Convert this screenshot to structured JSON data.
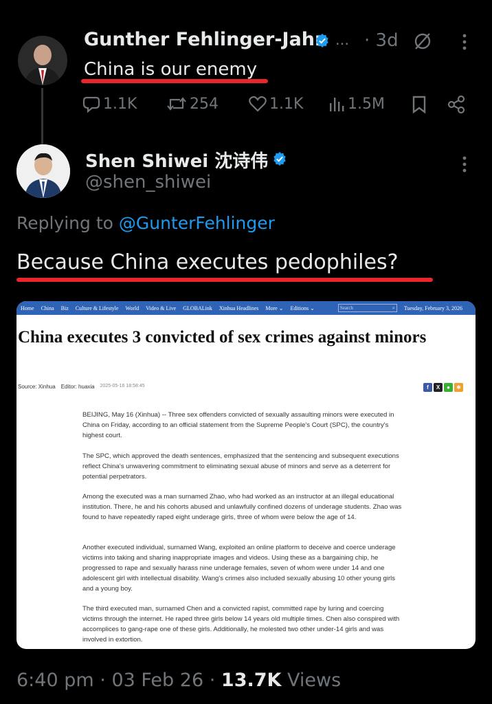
{
  "tweet1": {
    "author": "Gunther Fehlinger-Jahn",
    "ellipsis": "...",
    "time": "· 3d",
    "text": "China is our enemy",
    "replies": "1.1K",
    "reposts": "254",
    "likes": "1.1K",
    "views": "1.5M"
  },
  "tweet2": {
    "author": "Shen Shiwei 沈诗伟",
    "handle": "@shen_shiwei",
    "replying_prefix": "Replying to",
    "replying_to": "@GunterFehlinger",
    "text": "Because China executes pedophiles?"
  },
  "article": {
    "nav": [
      "Home",
      "China",
      "Biz",
      "Culture & Lifestyle",
      "World",
      "Video & Live",
      "GLOBALink",
      "Xinhua Headlines",
      "More ⌄",
      "Editions ⌄"
    ],
    "search_placeholder": "Search",
    "date": "Tuesday, February 3, 2026",
    "headline": "China executes 3 convicted of sex crimes against minors",
    "source": "Source: Xinhua",
    "editor": "Editor: huaxia",
    "timestamp": "2025-05-16 18:58:45",
    "paragraphs": [
      "BEIJING, May 16 (Xinhua) -- Three sex offenders convicted of sexually assaulting minors were executed in China on Friday, according to an official statement from the Supreme People's Court (SPC), the country's highest court.",
      "The SPC, which approved the death sentences, emphasized that the sentencing and subsequent executions reflect China's unwavering commitment to eliminating sexual abuse of minors and serve as a deterrent for potential perpetrators.",
      "Among the executed was a man surnamed Zhao, who had worked as an instructor at an illegal educational institution. There, he and his cohorts abused and unlawfully confined dozens of underage students. Zhao was found to have repeatedly raped eight underage girls, three of whom were below the age of 14.",
      "Another executed individual, surnamed Wang, exploited an online platform to deceive and coerce underage victims into taking and sharing inappropriate images and videos. Using these as a bargaining chip, he progressed to rape and sexually harass nine underage females, seven of whom were under 14 and one adolescent girl with intellectual disability. Wang's crimes also included sexually abusing 10 other young girls and a young boy.",
      "The third executed man, surnamed Chen and a convicted rapist, committed rape by luring and coercing victims through the internet. He raped three girls below 14 years old multiple times. Chen also conspired with accomplices to gang-rape one of these girls. Additionally, he molested two other under-14 girls and was involved in extortion."
    ]
  },
  "footer": {
    "time": "6:40 pm",
    "sep1": "·",
    "date": "03 Feb 26",
    "sep2": "·",
    "views": "13.7K",
    "views_label": "Views"
  },
  "colors": {
    "background": "#000000",
    "accent": "#1d9bf0",
    "muted": "#71767b",
    "underline": "#e8262c"
  }
}
